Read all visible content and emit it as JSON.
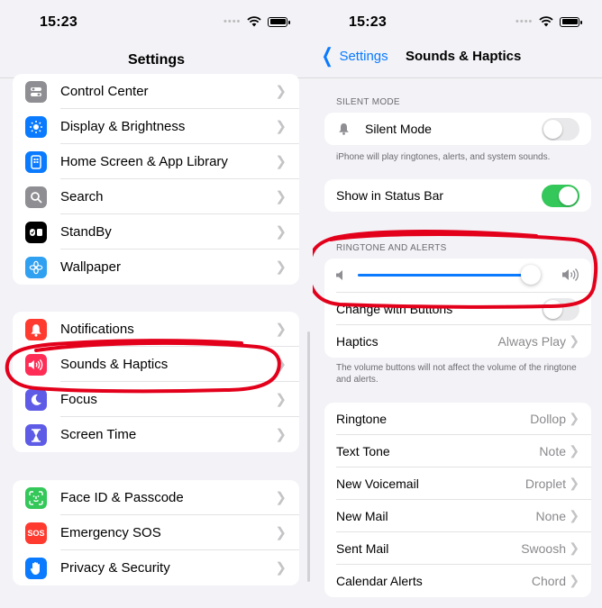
{
  "left": {
    "time": "15:23",
    "title": "Settings",
    "groups": [
      [
        {
          "label": "Control Center",
          "icon": "switches-icon",
          "color": "#8e8e93"
        },
        {
          "label": "Display & Brightness",
          "icon": "sun-icon",
          "color": "#0a7aff"
        },
        {
          "label": "Home Screen & App Library",
          "icon": "phone-grid-icon",
          "color": "#0a7aff"
        },
        {
          "label": "Search",
          "icon": "magnifier-icon",
          "color": "#8e8e93"
        },
        {
          "label": "StandBy",
          "icon": "standby-icon",
          "color": "#000000"
        },
        {
          "label": "Wallpaper",
          "icon": "flower-icon",
          "color": "#30a0f0"
        }
      ],
      [
        {
          "label": "Notifications",
          "icon": "bell-icon",
          "color": "#ff3b30"
        },
        {
          "label": "Sounds & Haptics",
          "icon": "speaker-icon",
          "color": "#ff2d55"
        },
        {
          "label": "Focus",
          "icon": "moon-icon",
          "color": "#5e5ce6"
        },
        {
          "label": "Screen Time",
          "icon": "hourglass-icon",
          "color": "#5e5ce6"
        }
      ],
      [
        {
          "label": "Face ID & Passcode",
          "icon": "face-id-icon",
          "color": "#34c759"
        },
        {
          "label": "Emergency SOS",
          "icon": "sos-icon",
          "color": "#ff3b30",
          "text": "SOS"
        },
        {
          "label": "Privacy & Security",
          "icon": "hand-icon",
          "color": "#0a7aff"
        }
      ]
    ]
  },
  "right": {
    "time": "15:23",
    "back_label": "Settings",
    "title": "Sounds & Haptics",
    "silent_section": "SILENT MODE",
    "silent_label": "Silent Mode",
    "silent_on": false,
    "silent_note": "iPhone will play ringtones, alerts, and system sounds.",
    "status_bar_label": "Show in Status Bar",
    "status_bar_on": true,
    "ringtone_section": "RINGTONE AND ALERTS",
    "volume_fraction": 0.95,
    "change_buttons_label": "Change with Buttons",
    "change_buttons_on": false,
    "haptics_label": "Haptics",
    "haptics_value": "Always Play",
    "volume_note": "The volume buttons will not affect the volume of the ringtone and alerts.",
    "sounds": [
      {
        "label": "Ringtone",
        "value": "Dollop"
      },
      {
        "label": "Text Tone",
        "value": "Note"
      },
      {
        "label": "New Voicemail",
        "value": "Droplet"
      },
      {
        "label": "New Mail",
        "value": "None"
      },
      {
        "label": "Sent Mail",
        "value": "Swoosh"
      },
      {
        "label": "Calendar Alerts",
        "value": "Chord"
      }
    ]
  },
  "colors": {
    "accent": "#0a7aff",
    "toggle_on": "#34c759",
    "annotation": "#e3001b"
  }
}
